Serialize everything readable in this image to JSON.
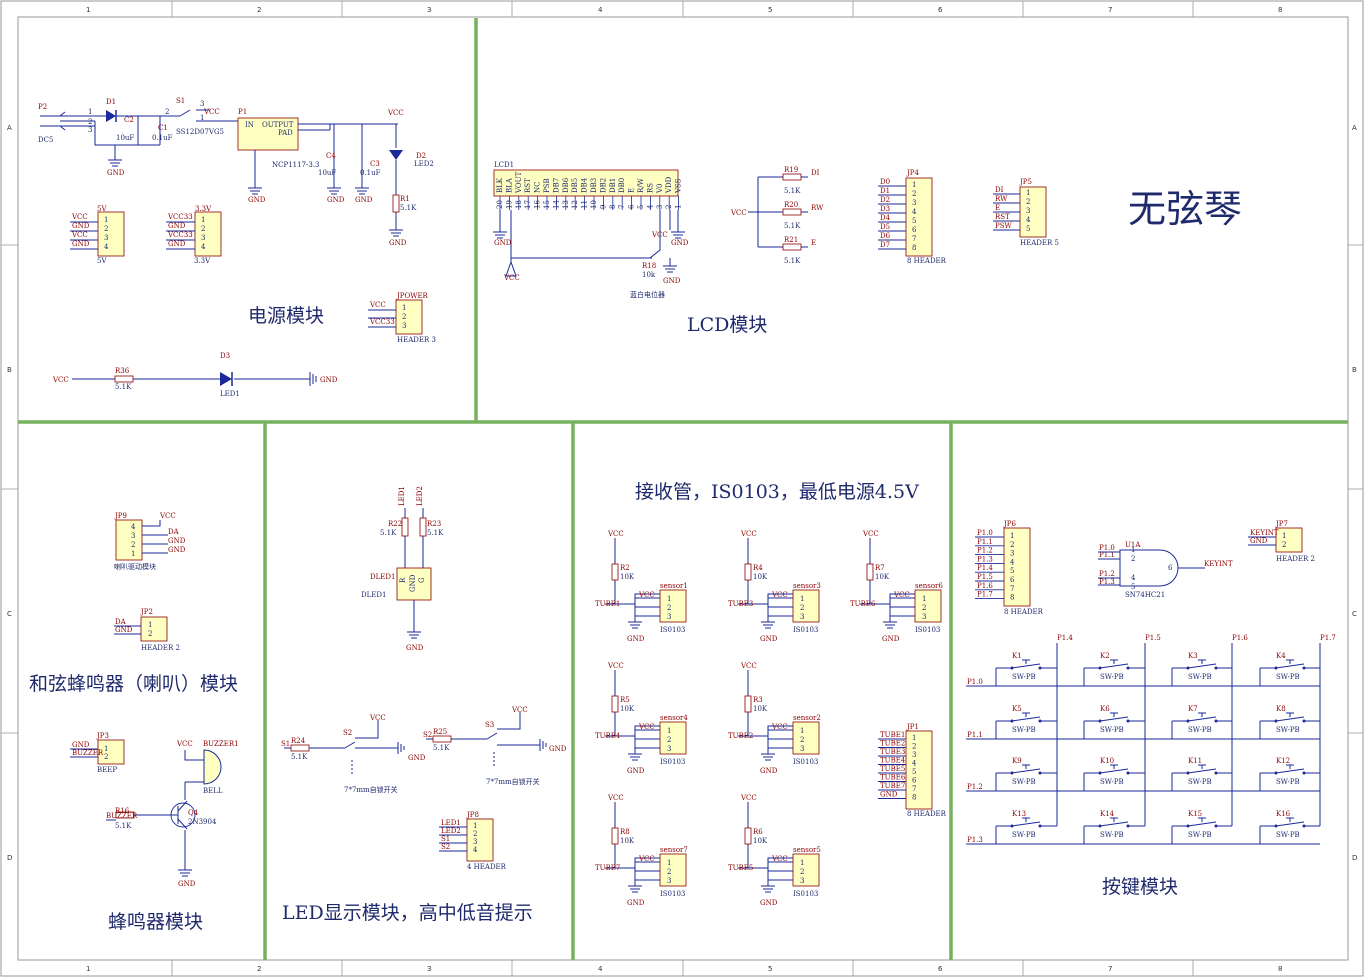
{
  "sheet": {
    "title": "无弦琴",
    "col_labels": [
      "1",
      "2",
      "3",
      "4",
      "5",
      "6",
      "7",
      "8"
    ],
    "row_labels": [
      "A",
      "B",
      "C",
      "D"
    ]
  },
  "modules": {
    "power": "电源模块",
    "lcd": "LCD模块",
    "speaker": "和弦蜂鸣器（喇叭）模块",
    "buzzer": "蜂鸣器模块",
    "led": "LED显示模块，高中低音提示",
    "receiver": "接收管，IS0103，最低电源4.5V",
    "keys": "按键模块"
  },
  "power": {
    "p2": "P2",
    "dc5": "DC5",
    "d1": "D1",
    "c2": "C2",
    "c2v": "10uF",
    "c1": "C1",
    "c1v": "0.1uF",
    "s1": "S1",
    "s1part": "SS12D07VG5",
    "vcc": "VCC",
    "gnd": "GND",
    "p1": "P1",
    "in": "IN",
    "output": "OUTPUT",
    "pad": "PAD",
    "reg": "NCP1117-3.3",
    "c4": "C4",
    "c4v": "10uF",
    "c3": "C3",
    "c3v": "0.1uF",
    "d2": "D2",
    "led2": "LED2",
    "r1": "R1",
    "r1v": "5.1K",
    "h5v": "5V",
    "h33": "3.3V",
    "vcc33": "VCC33",
    "jpower": "JPOWER",
    "header3": "HEADER 3",
    "r36": "R36",
    "r36v": "5.1K",
    "d3": "D3",
    "led1": "LED1"
  },
  "lcd": {
    "ref": "LCD1",
    "pins": [
      "BLK",
      "BLA",
      "VOUT",
      "RST",
      "NC",
      "PSB",
      "DB7",
      "DB6",
      "DB5",
      "DB4",
      "DB3",
      "DB2",
      "DB1",
      "DB0",
      "E",
      "R/W",
      "RS",
      "V0",
      "VDD",
      "VSS"
    ],
    "r18": "R18",
    "r18v": "10k",
    "pot": "蓝白电位器",
    "r19": "R19",
    "r20": "R20",
    "r21": "R21",
    "rv": "5.1K",
    "di": "DI",
    "rw": "RW",
    "e": "E",
    "jp4": "JP4",
    "jp4pins": [
      "D0",
      "D1",
      "D2",
      "D3",
      "D4",
      "D5",
      "D6",
      "D7"
    ],
    "header8": "8 HEADER",
    "jp5": "JP5",
    "jp5pins": [
      "DI",
      "RW",
      "E",
      "RST",
      "PSW"
    ],
    "header5": "HEADER 5"
  },
  "speaker": {
    "jp9": "JP9",
    "jp9pins": [
      "VCC",
      "DA",
      "GND",
      "GND"
    ],
    "jp9label": "喇叭驱动模块",
    "jp2": "JP2",
    "jp2pins": [
      "DA",
      "GND"
    ],
    "header2": "HEADER 2"
  },
  "buzzer": {
    "jp3": "JP3",
    "jp3pins": [
      "GND",
      "BUZZER"
    ],
    "beep": "BEEP",
    "buzzer1": "BUZZER1",
    "bell": "BELL",
    "r16": "R16",
    "r16v": "5.1K",
    "q4": "Q4",
    "q4p": "2N3904",
    "buzzer_net": "BUZZER"
  },
  "led": {
    "led1": "LED1",
    "led2": "LED2",
    "r22": "R22",
    "r23": "R23",
    "rv": "5.1K",
    "dled1": "DLED1",
    "s1": "S1",
    "s2": "S2",
    "s3": "S3",
    "r24": "R24",
    "r25": "R25",
    "sw": "7*7mm自锁开关",
    "jp8": "JP8",
    "jp8pins": [
      "LED1",
      "LED2",
      "S1",
      "S2"
    ],
    "header4": "4 HEADER"
  },
  "receiver": {
    "units": [
      {
        "r": "R2",
        "tube": "TUBE1",
        "sensor": "sensor1"
      },
      {
        "r": "R4",
        "tube": "TUBE3",
        "sensor": "sensor3"
      },
      {
        "r": "R7",
        "tube": "TUBE6",
        "sensor": "sensor6"
      },
      {
        "r": "R5",
        "tube": "TUBE4",
        "sensor": "sensor4"
      },
      {
        "r": "R3",
        "tube": "TUBE2",
        "sensor": "sensor2"
      },
      {
        "r": "R8",
        "tube": "TUBE7",
        "sensor": "sensor7"
      },
      {
        "r": "R6",
        "tube": "TUBE5",
        "sensor": "sensor5"
      }
    ],
    "rv": "10K",
    "part": "IS0103",
    "jp1": "JP1",
    "jp1pins": [
      "TUBE1",
      "TUBE2",
      "TUBE3",
      "TUBE4",
      "TUBE5",
      "TUBE6",
      "TUBE7",
      "GND"
    ],
    "header8": "8 HEADER"
  },
  "keys": {
    "jp6": "JP6",
    "jp6pins": [
      "P1.0",
      "P1.1",
      "P1.2",
      "P1.3",
      "P1.4",
      "P1.5",
      "P1.6",
      "P1.7"
    ],
    "header8": "8 HEADER",
    "u1": "U1A",
    "u1part": "SN74HC21",
    "keyint": "KEYINT",
    "jp7": "JP7",
    "jp7pins": [
      "KEYINT",
      "GND"
    ],
    "header2": "HEADER 2",
    "cols": [
      "P1.4",
      "P1.5",
      "P1.6",
      "P1.7"
    ],
    "rows": [
      "P1.0",
      "P1.1",
      "P1.2",
      "P1.3"
    ],
    "keys": [
      "K1",
      "K2",
      "K3",
      "K4",
      "K5",
      "K6",
      "K7",
      "K8",
      "K9",
      "K10",
      "K11",
      "K12",
      "K13",
      "K14",
      "K15",
      "K16"
    ],
    "swpb": "SW-PB"
  }
}
